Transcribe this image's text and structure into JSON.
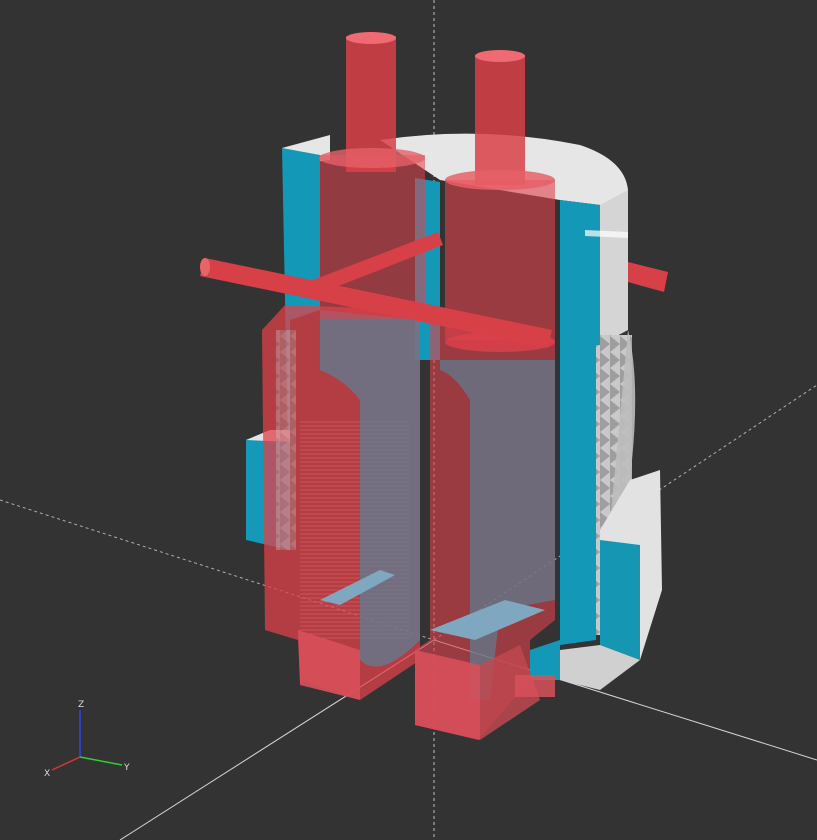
{
  "viewport": {
    "background": "#333333",
    "colors": {
      "translucent_red": "#e0414b",
      "solid_red": "#d8505a",
      "section_cyan": "#1299b8",
      "section_cyan_dark": "#0f7f99",
      "surface_white": "#e8e8e8",
      "surface_gray": "#b9b9b9",
      "axis_line": "#ffffff"
    }
  },
  "axis_gizmo": {
    "x_label": "X",
    "y_label": "Y",
    "z_label": "Z",
    "x_color": "#d33",
    "y_color": "#3c3",
    "z_color": "#33d"
  },
  "icons": [
    "axis-gizmo-icon"
  ]
}
